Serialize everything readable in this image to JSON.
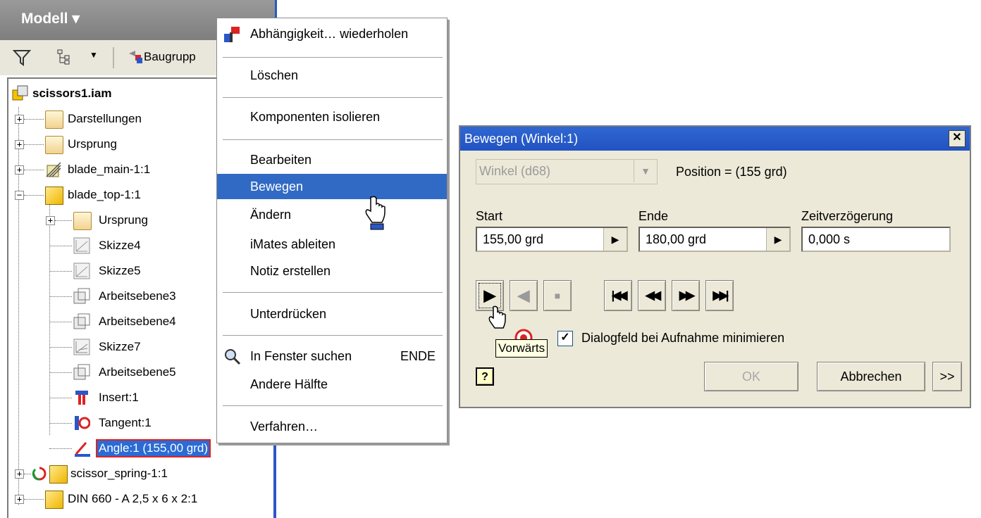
{
  "browser": {
    "title": "Modell ▾",
    "toolbar": {
      "assemble_label": "Baugrupp"
    },
    "tree": [
      {
        "label": "scissors1.iam",
        "bold": true
      },
      {
        "label": "Darstellungen"
      },
      {
        "label": "Ursprung"
      },
      {
        "label": "blade_main-1:1"
      },
      {
        "label": "blade_top-1:1"
      },
      {
        "label": "Ursprung"
      },
      {
        "label": "Skizze4"
      },
      {
        "label": "Skizze5"
      },
      {
        "label": "Arbeitsebene3"
      },
      {
        "label": "Arbeitsebene4"
      },
      {
        "label": "Skizze7"
      },
      {
        "label": "Arbeitsebene5"
      },
      {
        "label": "Insert:1"
      },
      {
        "label": "Tangent:1"
      },
      {
        "label": "Angle:1 (155,00 grd)"
      },
      {
        "label": "scissor_spring-1:1"
      },
      {
        "label": "DIN 660 - A 2,5 x 6 x 2:1"
      }
    ]
  },
  "context_menu": {
    "items": [
      {
        "label": "Abhängigkeit… wiederholen"
      },
      {
        "label": "Löschen"
      },
      {
        "label": "Komponenten isolieren"
      },
      {
        "label": "Bearbeiten"
      },
      {
        "label": "Bewegen"
      },
      {
        "label": "Ändern"
      },
      {
        "label": "iMates ableiten"
      },
      {
        "label": "Notiz erstellen"
      },
      {
        "label": "Unterdrücken"
      },
      {
        "label": "In Fenster suchen",
        "shortcut": "ENDE"
      },
      {
        "label": "Andere Hälfte"
      },
      {
        "label": "Verfahren…"
      }
    ]
  },
  "dialog": {
    "title": "Bewegen (Winkel:1)",
    "close": "✕",
    "parameter_select": "Winkel (d68)",
    "position_text": "Position = (155 grd)",
    "start_label": "Start",
    "start_value": "155,00 grd",
    "end_label": "Ende",
    "end_value": "180,00 grd",
    "delay_label": "Zeitverzögerung",
    "delay_value": "0,000 s",
    "tooltip": "Vorwärts",
    "minimize_label": "Dialogfeld bei Aufnahme minimieren",
    "ok_label": "OK",
    "cancel_label": "Abbrechen",
    "more_label": ">>",
    "help_label": "?"
  }
}
